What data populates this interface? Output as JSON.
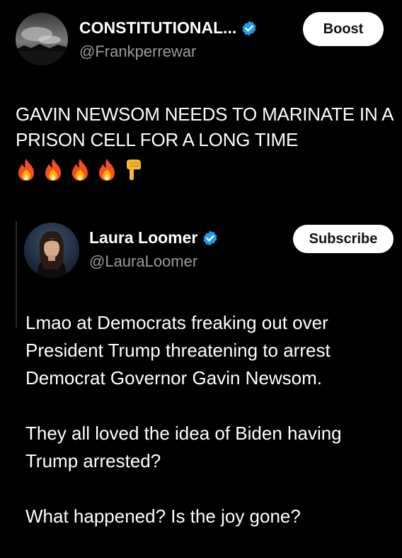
{
  "main_post": {
    "author": {
      "display_name": "CONSTITUTIONAL...",
      "handle": "@Frankperrewar",
      "verified": true
    },
    "boost_label": "Boost",
    "text": "GAVIN NEWSOM NEEDS TO MARINATE IN A PRISON CELL FOR A LONG TIME",
    "emojis": [
      "fire-icon",
      "fire-icon",
      "fire-icon",
      "fire-icon",
      "pointing-down-icon"
    ]
  },
  "quoted_post": {
    "author": {
      "display_name": "Laura Loomer",
      "handle": "@LauraLoomer",
      "verified": true
    },
    "subscribe_label": "Subscribe",
    "paragraphs": [
      "Lmao at Democrats freaking out over President Trump threatening to arrest Democrat Governor Gavin Newsom.",
      "They all loved the idea of Biden having Trump arrested?",
      "What happened? Is the joy gone?"
    ]
  },
  "colors": {
    "background": "#000000",
    "text": "#ffffff",
    "handle": "#9a9a9a",
    "verified": "#1d9bf0",
    "button_bg": "#ffffff",
    "button_text": "#111111"
  }
}
